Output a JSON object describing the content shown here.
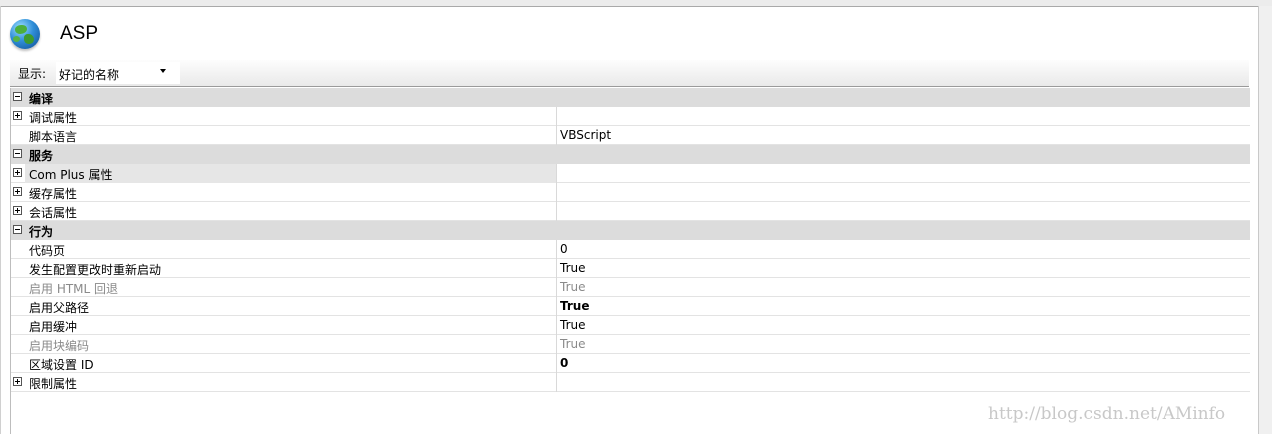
{
  "header": {
    "title": "ASP",
    "icon": "globe-icon"
  },
  "toolbar": {
    "show_label": "显示:",
    "display_mode": "好记的名称"
  },
  "grid": {
    "rows": [
      {
        "type": "category",
        "expander": "minus",
        "name": "编译",
        "value": ""
      },
      {
        "type": "item",
        "expander": "plus",
        "name": "调试属性",
        "value": ""
      },
      {
        "type": "item",
        "expander": "none",
        "name": "脚本语言",
        "value": "VBScript"
      },
      {
        "type": "category",
        "expander": "minus",
        "name": "服务",
        "value": ""
      },
      {
        "type": "item",
        "expander": "plus",
        "name": "Com Plus 属性",
        "value": "",
        "selected": true
      },
      {
        "type": "item",
        "expander": "plus",
        "name": "缓存属性",
        "value": ""
      },
      {
        "type": "item",
        "expander": "plus",
        "name": "会话属性",
        "value": ""
      },
      {
        "type": "category",
        "expander": "minus",
        "name": "行为",
        "value": ""
      },
      {
        "type": "item",
        "expander": "none",
        "name": "代码页",
        "value": "0"
      },
      {
        "type": "item",
        "expander": "none",
        "name": "发生配置更改时重新启动",
        "value": "True"
      },
      {
        "type": "item",
        "expander": "none",
        "name": "启用 HTML 回退",
        "value": "True",
        "disabled": true
      },
      {
        "type": "item",
        "expander": "none",
        "name": "启用父路径",
        "value": "True",
        "bold": true
      },
      {
        "type": "item",
        "expander": "none",
        "name": "启用缓冲",
        "value": "True"
      },
      {
        "type": "item",
        "expander": "none",
        "name": "启用块编码",
        "value": "True",
        "disabled": true
      },
      {
        "type": "item",
        "expander": "none",
        "name": "区域设置 ID",
        "value": "0",
        "bold": true
      },
      {
        "type": "item",
        "expander": "plus",
        "name": "限制属性",
        "value": ""
      }
    ]
  },
  "watermark": "http://blog.csdn.net/AMinfo"
}
